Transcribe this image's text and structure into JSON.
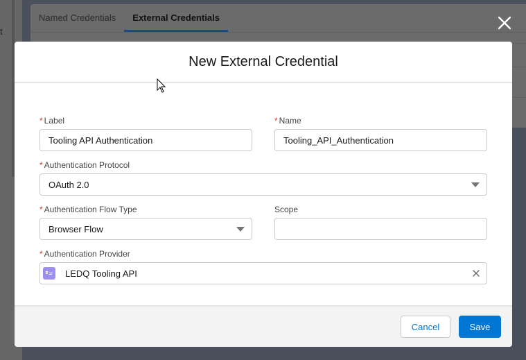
{
  "background": {
    "left_stub_text": "t",
    "tabs": [
      {
        "label": "Named Credentials",
        "active": false
      },
      {
        "label": "External Credentials",
        "active": true
      }
    ]
  },
  "modal": {
    "title": "New External Credential",
    "close_icon": "close-icon",
    "fields": {
      "label": {
        "label": "Label",
        "required": true,
        "value": "Tooling API Authentication"
      },
      "name": {
        "label": "Name",
        "required": true,
        "value": "Tooling_API_Authentication"
      },
      "auth_protocol": {
        "label": "Authentication Protocol",
        "required": true,
        "value": "OAuth 2.0"
      },
      "auth_flow_type": {
        "label": "Authentication Flow Type",
        "required": true,
        "value": "Browser Flow"
      },
      "scope": {
        "label": "Scope",
        "required": false,
        "value": ""
      },
      "auth_provider": {
        "label": "Authentication Provider",
        "required": true,
        "value": "LEDQ Tooling API",
        "icon": "auth-provider-icon"
      }
    },
    "required_marker": "*",
    "footer": {
      "cancel_label": "Cancel",
      "save_label": "Save"
    }
  },
  "colors": {
    "brand": "#0176d3",
    "required": "#c23934",
    "provider_icon": "#9c8ff0",
    "active_tab_underline": "#1b4a82"
  }
}
